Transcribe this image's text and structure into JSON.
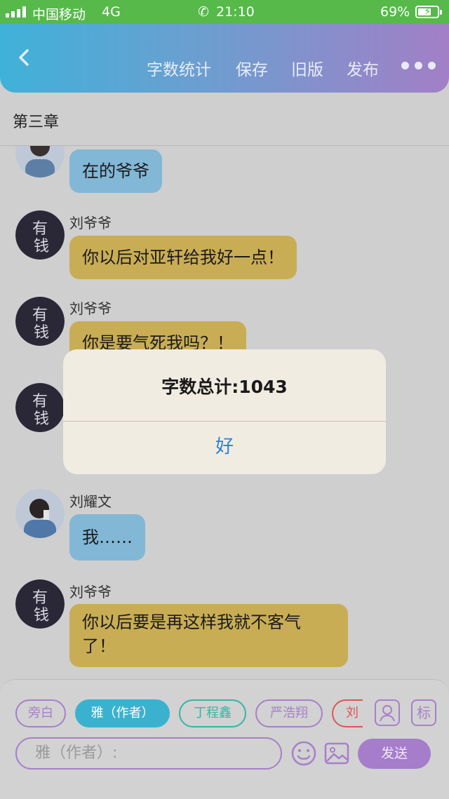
{
  "status_bar": {
    "carrier": "中国移动",
    "network": "4G",
    "time": "21:10",
    "battery": "69%",
    "battery_level": 0.69
  },
  "nav": {
    "actions": [
      "字数统计",
      "保存",
      "旧版",
      "发布"
    ]
  },
  "chapter_title": "第三章",
  "messages": [
    {
      "sender": "",
      "text": "在的爷爷",
      "style": "blue",
      "avatar": "photo-avatar"
    },
    {
      "sender": "刘爷爷",
      "text": "你以后对亚轩给我好一点！",
      "style": "gold",
      "avatar": "money-avatar"
    },
    {
      "sender": "刘爷爷",
      "text": "你是要气死我吗？！",
      "style": "gold",
      "avatar": "money-avatar"
    },
    {
      "sender": "刘耀文",
      "text": "我……",
      "style": "blue",
      "avatar": "photo-avatar"
    },
    {
      "sender": "刘爷爷",
      "line1": "你以后要是再这样我就不客气",
      "line2": "了！",
      "style": "gold",
      "avatar": "money-avatar"
    }
  ],
  "alert": {
    "message": "字数总计:1043",
    "ok_label": "好"
  },
  "composer": {
    "characters": [
      "旁白",
      "雅（作者）",
      "丁程鑫",
      "严浩翔",
      "刘"
    ],
    "selected_character": "雅（作者）",
    "tag_label": "标",
    "input_placeholder": "雅（作者）:",
    "send_label": "发送"
  },
  "colors": {
    "status_bar": "#56b94a",
    "nav_gradient_start": "#3fb2d9",
    "nav_gradient_end": "#a27fc6",
    "bubble_blue": "#82b7d6",
    "bubble_gold": "#c9ad55",
    "accent_purple": "#a77fcb",
    "alert_button": "#2c7fd8"
  }
}
